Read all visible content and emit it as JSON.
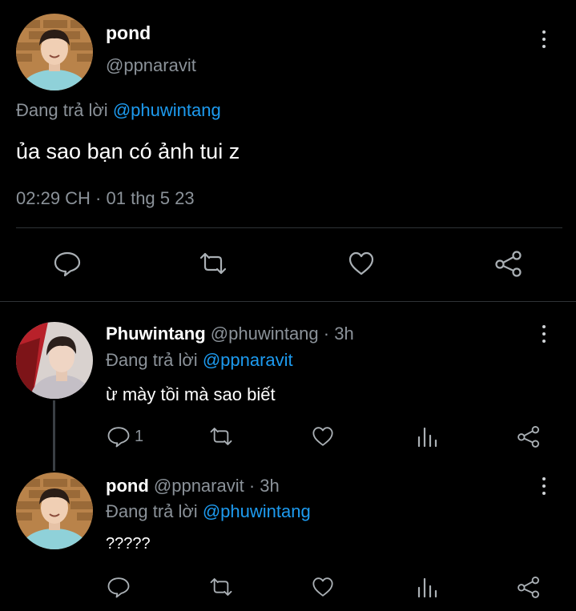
{
  "main_tweet": {
    "display_name": "pond",
    "handle": "@ppnaravit",
    "reply_prefix": "Đang trả lời",
    "reply_to": "@phuwintang",
    "text": "ủa sao bạn có ảnh tui z",
    "timestamp": "02:29 CH · 01 thg 5 23"
  },
  "replies": [
    {
      "display_name": "Phuwintang",
      "handle": "@phuwintang",
      "time": "· 3h",
      "reply_prefix": "Đang trả lời",
      "reply_to": "@ppnaravit",
      "text": "ừ mày tồi mà sao biết",
      "reply_count": "1"
    },
    {
      "display_name": "pond",
      "handle": "@ppnaravit",
      "time": "· 3h",
      "reply_prefix": "Đang trả lời",
      "reply_to": "@phuwintang",
      "text": "?????"
    }
  ],
  "colors": {
    "background": "#000000",
    "link_blue": "#1d9bf0",
    "muted_gray": "#8b9299",
    "divider": "#2f3336"
  },
  "icons": [
    "more-vertical-icon",
    "comment-icon",
    "retweet-icon",
    "like-icon",
    "share-icon",
    "analytics-icon"
  ]
}
